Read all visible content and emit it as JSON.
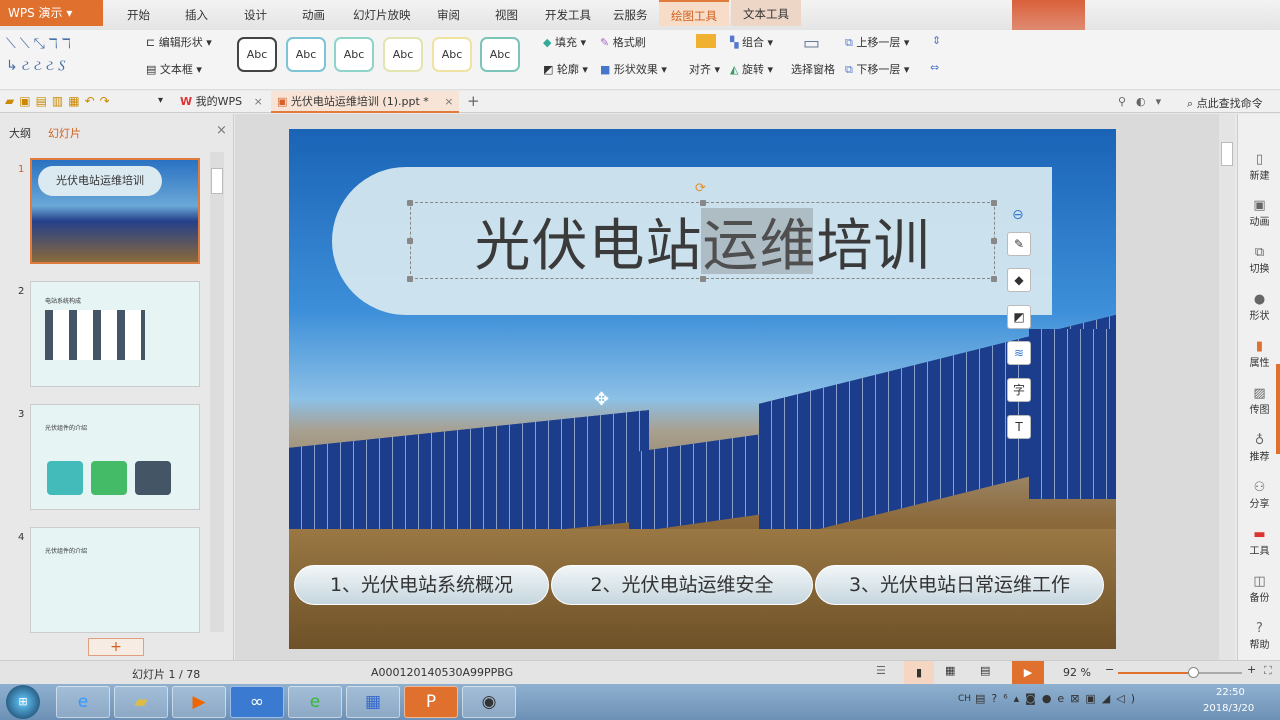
{
  "app": {
    "name": "WPS 演示"
  },
  "menu": [
    "开始",
    "插入",
    "设计",
    "动画",
    "幻灯片放映",
    "审阅",
    "视图",
    "开发工具",
    "云服务",
    "绘图工具",
    "文本工具"
  ],
  "ribbon": {
    "edit_shape": "编辑形状",
    "text_box": "文本框",
    "style_sample": "Abc",
    "fill": "填充",
    "format_painter": "格式刷",
    "outline": "轮廓",
    "shape_effect": "形状效果",
    "align": "对齐",
    "group": "组合",
    "rotate": "旋转",
    "selection_pane": "选择窗格",
    "bring_forward": "上移一层",
    "send_backward": "下移一层"
  },
  "tabs": {
    "home": "我的WPS",
    "doc": "光伏电站运维培训 (1).ppt *"
  },
  "search": {
    "placeholder": "点此查找命令"
  },
  "leftpane": {
    "outline": "大纲",
    "slides": "幻灯片",
    "thumbs": [
      {
        "num": "1",
        "title": "光伏电站运维培训"
      },
      {
        "num": "2",
        "title": "电站系统构成"
      },
      {
        "num": "3",
        "title": "光伏组件的介绍"
      },
      {
        "num": "4",
        "title": "光伏组件的介绍"
      }
    ]
  },
  "slide": {
    "title": "光伏电站运维培训",
    "title_highlight": "运维",
    "items": [
      "1、光伏电站系统概况",
      "2、光伏电站运维安全",
      "3、光伏电站日常运维工作"
    ]
  },
  "rightbar": [
    "新建",
    "动画",
    "切换",
    "形状",
    "属性",
    "传图",
    "推荐",
    "分享",
    "工具",
    "备份",
    "帮助"
  ],
  "status": {
    "slide": "幻灯片 1 / 78",
    "template": "A000120140530A99PPBG",
    "zoom": "92 %",
    "zoom_level": 92
  },
  "tray": {
    "ime": "CH",
    "time": "22:50",
    "date": "2018/3/20"
  },
  "colors": {
    "accent": "#e0702e"
  }
}
